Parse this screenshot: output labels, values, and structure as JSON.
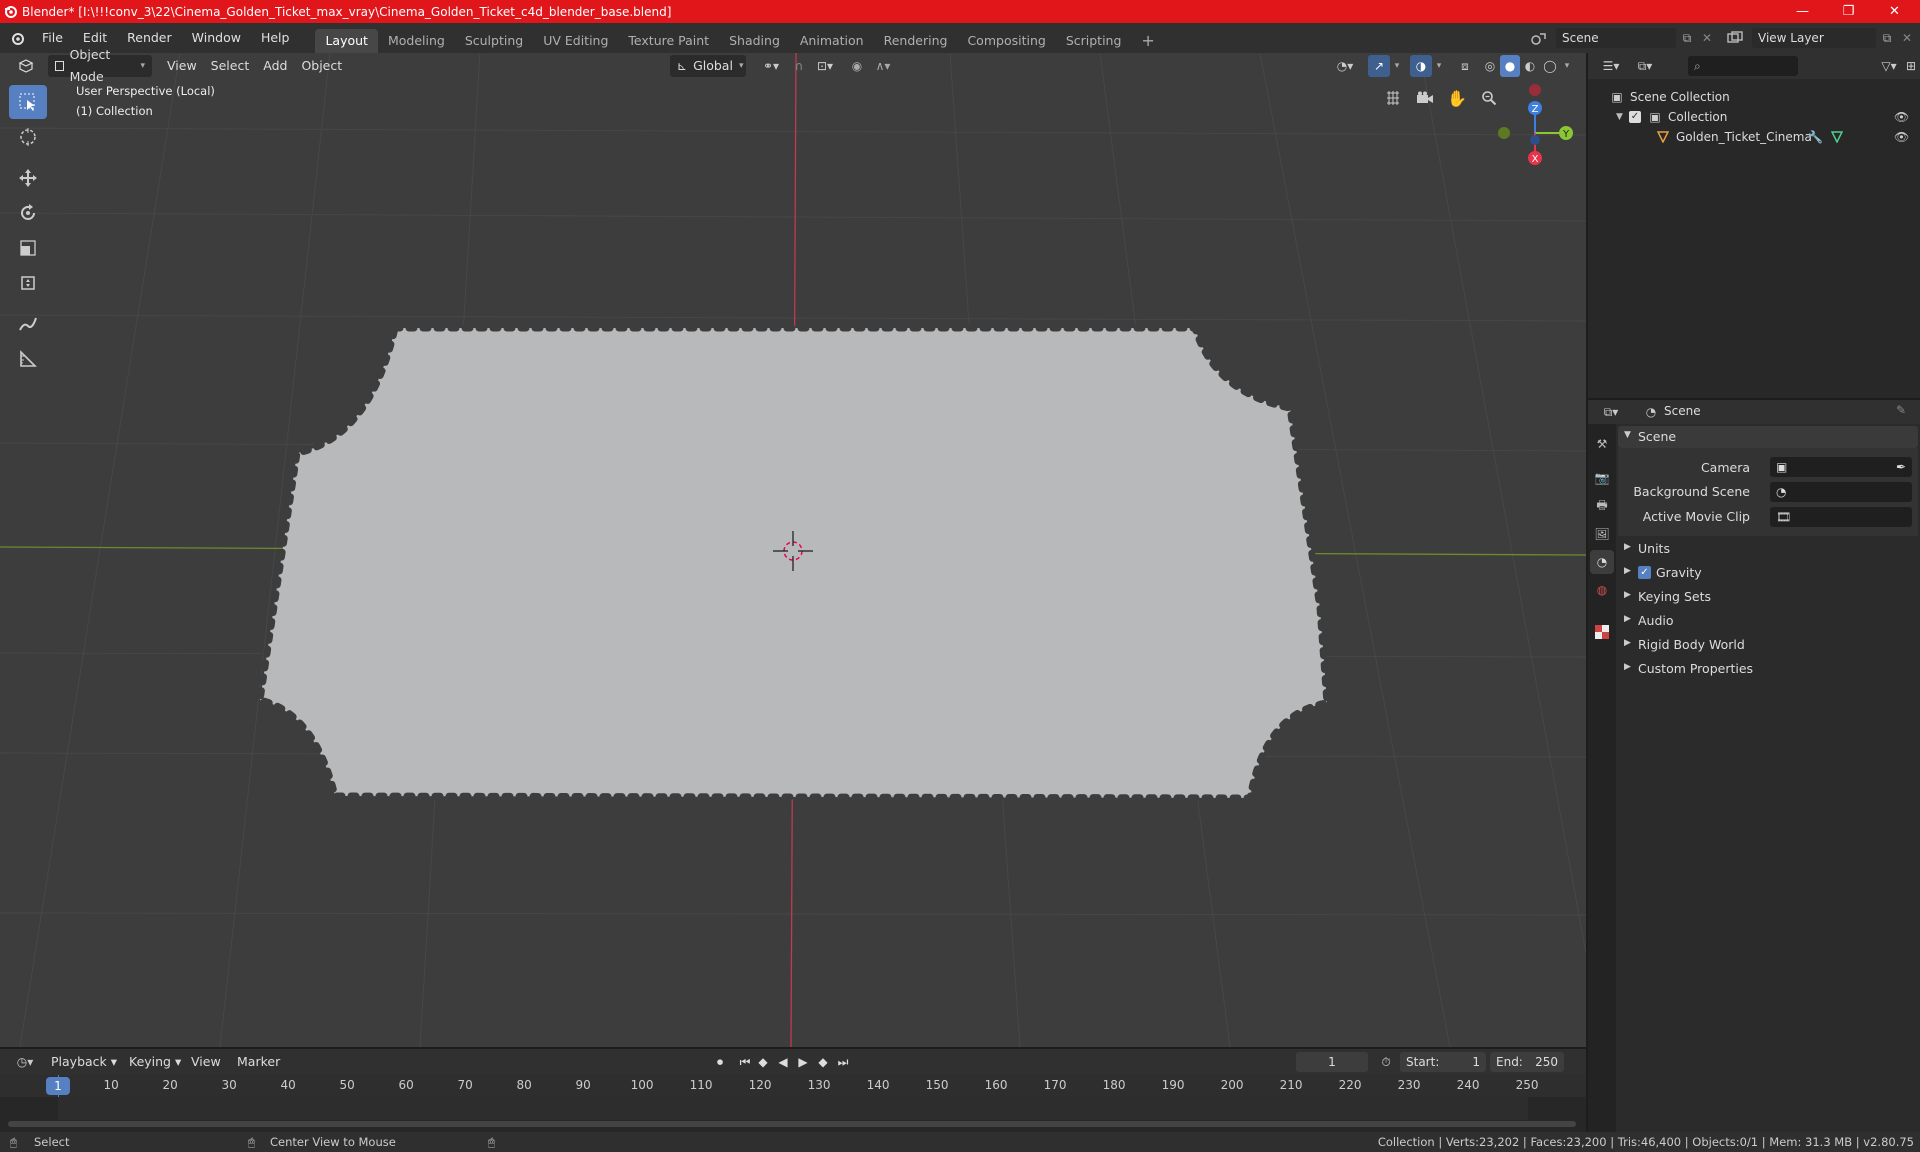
{
  "window": {
    "title": "Blender* [I:\\!!!conv_3\\22\\Cinema_Golden_Ticket_max_vray\\Cinema_Golden_Ticket_c4d_blender_base.blend]"
  },
  "menu": {
    "file": "File",
    "edit": "Edit",
    "render": "Render",
    "window": "Window",
    "help": "Help"
  },
  "workspaces": [
    "Layout",
    "Modeling",
    "Sculpting",
    "UV Editing",
    "Texture Paint",
    "Shading",
    "Animation",
    "Rendering",
    "Compositing",
    "Scripting"
  ],
  "scene_field": "Scene",
  "view_layer_field": "View Layer",
  "viewport": {
    "mode": "Object Mode",
    "menus": [
      "View",
      "Select",
      "Add",
      "Object"
    ],
    "orientation": "Global",
    "overlay_line1": "User Perspective (Local)",
    "overlay_line2": "(1) Collection",
    "gizmo": {
      "x": "X",
      "y": "Y",
      "z": "Z"
    }
  },
  "outliner": {
    "root": "Scene Collection",
    "collection": "Collection",
    "object": "Golden_Ticket_Cinema"
  },
  "properties": {
    "context": "Scene",
    "panel": "Scene",
    "camera_label": "Camera",
    "background_scene_label": "Background Scene",
    "movie_clip_label": "Active Movie Clip",
    "sections": [
      "Units",
      "Gravity",
      "Keying Sets",
      "Audio",
      "Rigid Body World",
      "Custom Properties"
    ],
    "gravity_checked": true
  },
  "timeline": {
    "menus": [
      "Playback",
      "Keying",
      "View",
      "Marker"
    ],
    "current_frame": "1",
    "start_label": "Start:",
    "start": "1",
    "end_label": "End:",
    "end": "250",
    "ticks": [
      "1",
      "10",
      "20",
      "30",
      "40",
      "50",
      "60",
      "70",
      "80",
      "90",
      "100",
      "110",
      "120",
      "130",
      "140",
      "150",
      "160",
      "170",
      "180",
      "190",
      "200",
      "210",
      "220",
      "230",
      "240",
      "250"
    ]
  },
  "status": {
    "select": "Select",
    "center_view": "Center View to Mouse",
    "stats": "Collection | Verts:23,202 | Faces:23,200 | Tris:46,400 | Objects:0/1 | Mem: 31.3 MB | v2.80.75"
  },
  "colors": {
    "title_bar": "#e1161b",
    "accent": "#5680c2",
    "x_axis": "#e8344b",
    "y_axis": "#8bc733",
    "z_axis": "#3f7fe0"
  }
}
